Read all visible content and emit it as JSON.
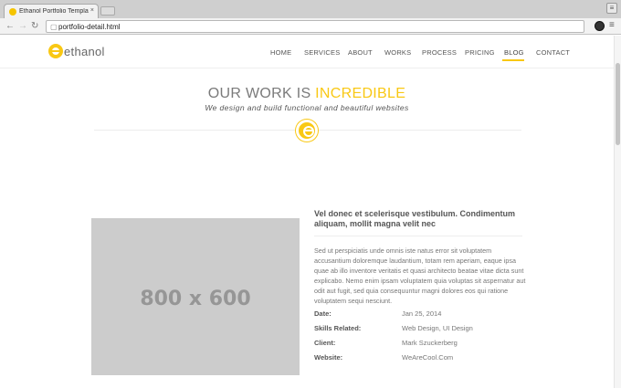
{
  "browser": {
    "tab_title": "Ethanol Portfolio Template",
    "tab_close": "×",
    "url": "portfolio-detail.html",
    "icons": {
      "back": "arrow-left",
      "forward": "arrow-right",
      "reload": "reload",
      "page": "page",
      "menu": "hamburger"
    }
  },
  "site": {
    "logo_text": "ethanol",
    "brand_color": "#f9c814",
    "nav": [
      {
        "label": "HOME"
      },
      {
        "label": "SERVICES"
      },
      {
        "label": "ABOUT"
      },
      {
        "label": "WORKS"
      },
      {
        "label": "PROCESS"
      },
      {
        "label": "PRICING"
      },
      {
        "label": "BLOG",
        "active": true
      },
      {
        "label": "CONTACT"
      }
    ],
    "hero": {
      "title_prefix": "OUR WORK IS",
      "title_accent": "INCREDIBLE",
      "subtitle": "We design and build functional and beautiful websites"
    },
    "project": {
      "image_label": "800 x 600",
      "title": "Vel donec et scelerisque vestibulum. Condimentum aliquam, mollit magna velit nec",
      "description": "Sed ut perspiciatis unde omnis iste natus error sit voluptatem accusantium doloremque laudantium, totam rem aperiam, eaque ipsa quae ab illo inventore veritatis et quasi architecto beatae vitae dicta sunt explicabo. Nemo enim ipsam voluptatem quia voluptas sit aspernatur aut odit aut fugit, sed quia consequuntur magni dolores eos qui ratione voluptatem sequi nesciunt.",
      "meta": [
        {
          "label": "Date:",
          "value": "Jan 25, 2014"
        },
        {
          "label": "Skills Related:",
          "value": "Web Design, UI Design"
        },
        {
          "label": "Client:",
          "value": "Mark Szuckerberg"
        },
        {
          "label": "Website:",
          "value": "WeAreCool.Com"
        }
      ]
    }
  }
}
